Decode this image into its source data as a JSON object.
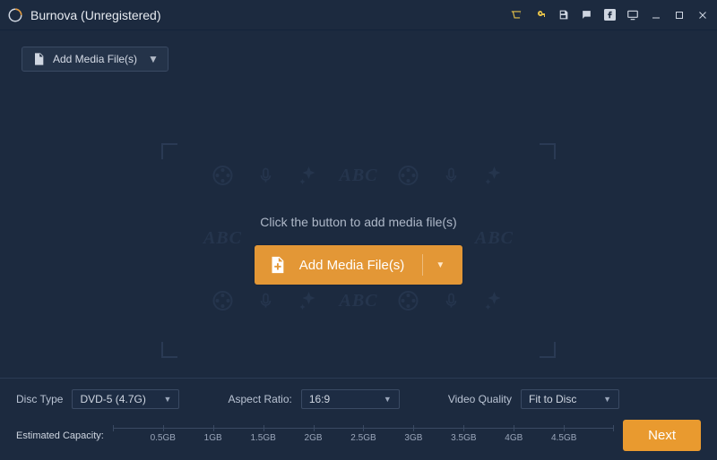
{
  "titlebar": {
    "title": "Burnova (Unregistered)"
  },
  "toolbar": {
    "add_small_label": "Add Media File(s)"
  },
  "stage": {
    "message": "Click the button to add media file(s)",
    "add_big_label": "Add Media File(s)",
    "ghost_text": "ABC"
  },
  "bottombar": {
    "disc_type_label": "Disc Type",
    "disc_type_value": "DVD-5 (4.7G)",
    "aspect_ratio_label": "Aspect Ratio:",
    "aspect_ratio_value": "16:9",
    "video_quality_label": "Video Quality",
    "video_quality_value": "Fit to Disc",
    "capacity_label": "Estimated Capacity:",
    "ticks": [
      "0.5GB",
      "1GB",
      "1.5GB",
      "2GB",
      "2.5GB",
      "3GB",
      "3.5GB",
      "4GB",
      "4.5GB"
    ],
    "next_label": "Next"
  }
}
